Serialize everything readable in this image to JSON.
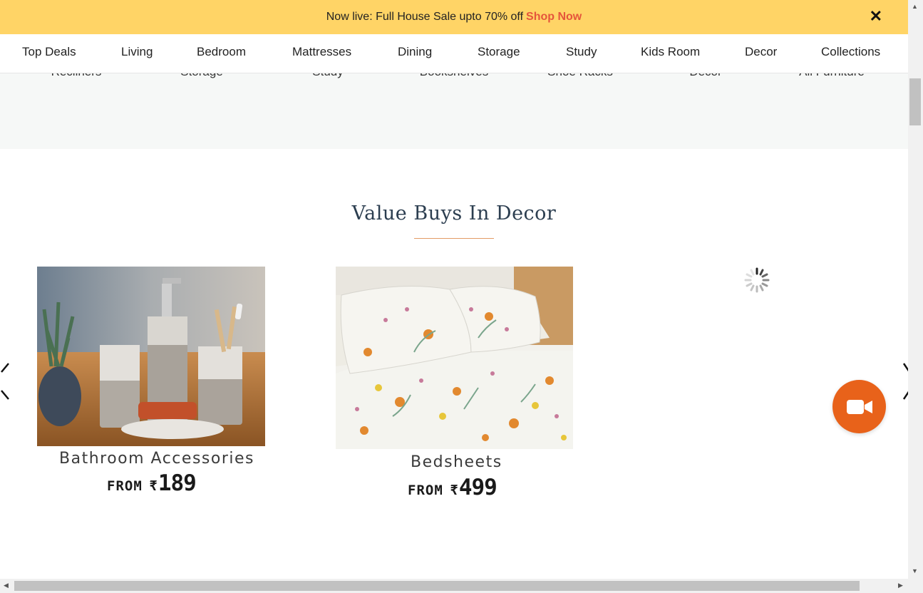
{
  "promo": {
    "text": "Now live: Full House Sale upto 70% off",
    "link": "Shop Now",
    "close": "✕"
  },
  "nav": {
    "items": [
      "Top Deals",
      "Living",
      "Bedroom",
      "Mattresses",
      "Dining",
      "Storage",
      "Study",
      "Kids Room",
      "Decor",
      "Collections"
    ]
  },
  "strip": {
    "items": [
      "Recliners",
      "Storage",
      "Study",
      "Bookshelves",
      "Shoe Racks",
      "Decor",
      "All Furniture"
    ]
  },
  "section": {
    "title": "Value Buys In Decor"
  },
  "products": [
    {
      "label": "Bathroom Accessories",
      "from": "FROM",
      "currency": "₹",
      "price": "189"
    },
    {
      "label": "Bedsheets",
      "from": "FROM",
      "currency": "₹",
      "price": "499"
    }
  ],
  "colors": {
    "banner": "#ffd466",
    "shop_now": "#e5553b",
    "title": "#2c3e50",
    "underline": "#e39b64",
    "video_button": "#e8621a"
  },
  "icons": {
    "close": "close-icon",
    "prev": "chevron-left-icon",
    "next": "chevron-right-icon",
    "video": "video-camera-icon",
    "loading": "loading-spinner-icon"
  }
}
